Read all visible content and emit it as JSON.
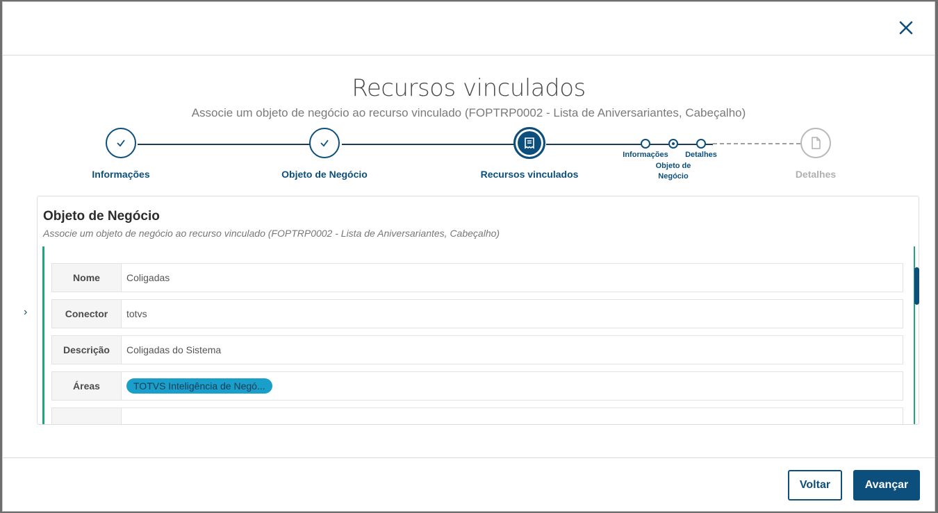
{
  "dialog": {
    "title": "Recursos vinculados",
    "subtitle": "Associe um objeto de negócio ao recurso vinculado (FOPTRP0002 - Lista de Aniversariantes, Cabeçalho)"
  },
  "stepper": {
    "steps": [
      {
        "label": "Informações",
        "state": "done",
        "icon": "check-icon"
      },
      {
        "label": "Objeto de Negócio",
        "state": "done",
        "icon": "check-icon"
      },
      {
        "label": "Recursos vinculados",
        "state": "active",
        "icon": "receipt-icon"
      },
      {
        "label": "Detalhes",
        "state": "disabled",
        "icon": "document-icon"
      }
    ],
    "substeps": [
      {
        "label": "Informações",
        "state": "done"
      },
      {
        "label": "Objeto de Negócio",
        "state": "current"
      },
      {
        "label": "Detalhes",
        "state": "pending"
      }
    ]
  },
  "panel": {
    "title": "Objeto de Negócio",
    "subtitle": "Associe um objeto de negócio ao recurso vinculado (FOPTRP0002 - Lista de Aniversariantes, Cabeçalho)",
    "fields": [
      {
        "label": "Nome",
        "value": "Coligadas"
      },
      {
        "label": "Conector",
        "value": "totvs"
      },
      {
        "label": "Descrição",
        "value": "Coligadas do Sistema"
      },
      {
        "label": "Áreas",
        "value": "TOTVS Inteligência de Negó..."
      }
    ]
  },
  "footer": {
    "back_label": "Voltar",
    "next_label": "Avançar"
  },
  "colors": {
    "primary": "#0c4f7c",
    "accent_green": "#1fa67a",
    "tag": "#1a9fca",
    "disabled": "#b0b0b0"
  }
}
